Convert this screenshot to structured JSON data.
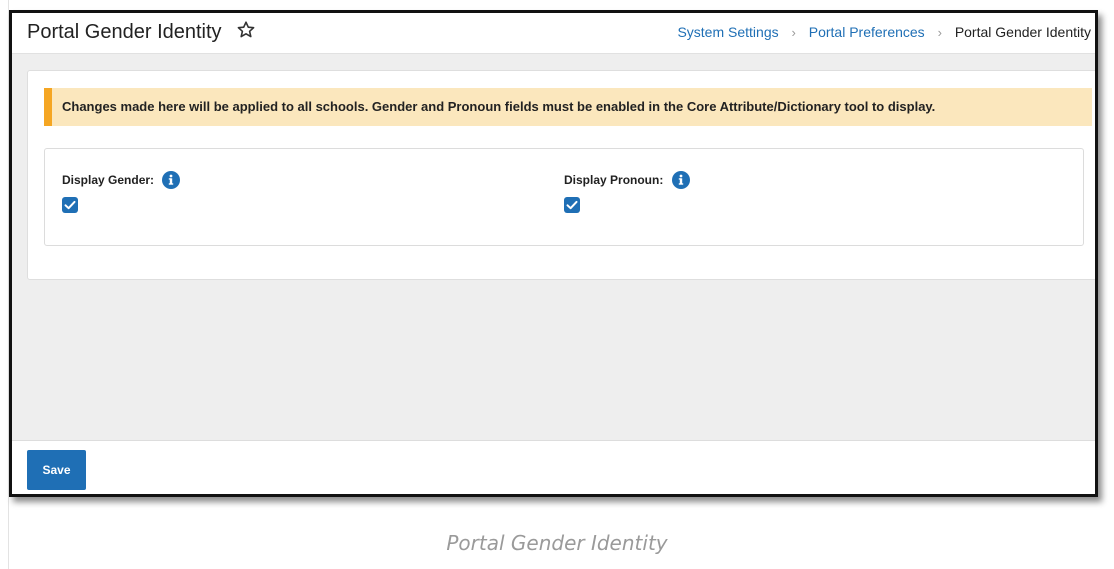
{
  "header": {
    "title": "Portal Gender Identity",
    "favorite_icon": "star-outline-icon",
    "breadcrumb": {
      "items": [
        "System Settings",
        "Portal Preferences"
      ],
      "current": "Portal Gender Identity",
      "separator_icon": "chevron-right-icon",
      "separator_glyph": "›"
    }
  },
  "alert": {
    "text": "Changes made here will be applied to all schools. Gender and Pronoun fields must be enabled in the Core Attribute/Dictionary tool to display.",
    "accent_color": "#f5a623",
    "background_color": "#fbe7bd"
  },
  "fields": {
    "display_gender": {
      "label": "Display Gender:",
      "checked": true,
      "info_icon": "info-icon"
    },
    "display_pronoun": {
      "label": "Display Pronoun:",
      "checked": true,
      "info_icon": "info-icon"
    }
  },
  "footer": {
    "save_label": "Save"
  },
  "caption": "Portal Gender Identity",
  "colors": {
    "primary": "#1f6fb5",
    "link": "#1f6fb5",
    "frame": "#111111",
    "content_bg": "#eeeeee"
  }
}
